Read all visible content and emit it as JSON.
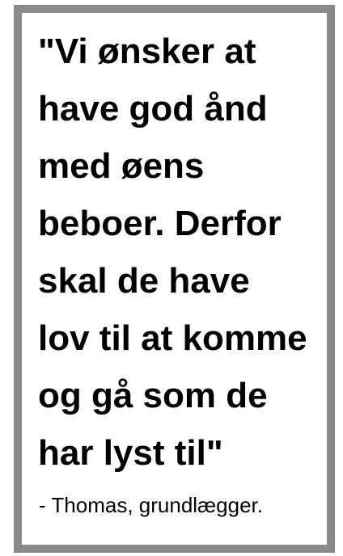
{
  "quote": {
    "lines": [
      "\"Vi ønsker at",
      "have god ånd",
      "med øens",
      "beboer. Derfor",
      "skal de have",
      "lov til at komme",
      "og gå som de",
      "har lyst til\""
    ]
  },
  "attribution": "- Thomas, grundlægger.",
  "colors": {
    "frame": "#8a8a8a",
    "background": "#ffffff",
    "text": "#000000"
  }
}
